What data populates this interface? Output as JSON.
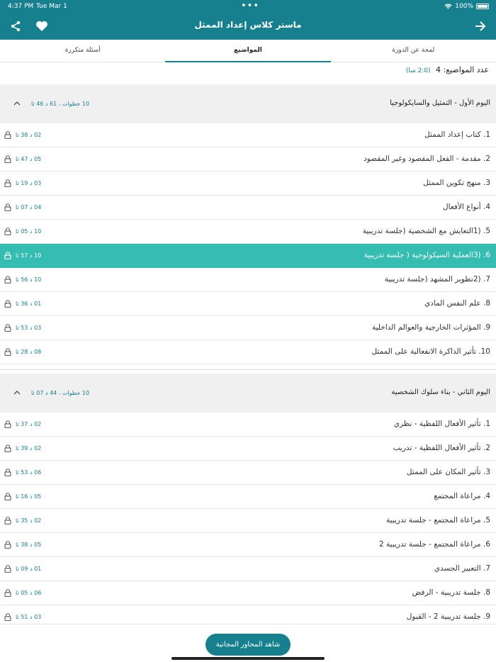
{
  "status_bar": {
    "time": "4:37 PM",
    "date": "Tue Mar 1",
    "dots": "•••",
    "battery": "100%"
  },
  "header": {
    "title": "ماستر كلاس إعداد الممثل",
    "share_icon": "share-icon",
    "heart_icon": "heart-icon",
    "back_icon": "arrow-right-icon",
    "color": "#17808f"
  },
  "tabs": [
    {
      "label": "لمحة عن الدورة"
    },
    {
      "label": "المواضيع"
    },
    {
      "label": "أسئلة متكررة"
    }
  ],
  "summary": {
    "label": "عدد المواضيع: 4",
    "duration": "(2:0 سا)"
  },
  "sections": [
    {
      "title": "اليوم الأول - التمثيل والسايكولوجيا",
      "meta": "10 خطوات ، 61 د 46 ثا",
      "items": [
        {
          "label": "1. كتاب إعداد الممثل",
          "duration": "02 د 38 ثا"
        },
        {
          "label": "2. مقدمة - الفعل المقصود وغير المقصود",
          "duration": "05 د 47 ثا"
        },
        {
          "label": "3. منهج تكوين الممثل",
          "duration": "03 د 19 ثا"
        },
        {
          "label": "4. أنواع الأفعال",
          "duration": "04 د 07 ثا"
        },
        {
          "label": "5. (1التعايش مع الشخصية (جلسة تدريبية",
          "duration": "10 د 05 ثا"
        },
        {
          "label": "6. (3العملية السيكولوجية ( جلسة تدريبية",
          "duration": "10 د 57 ثا"
        },
        {
          "label": "7. (2تطوير المشهد (جلسة تدريبية",
          "duration": "10 د 56 ثا"
        },
        {
          "label": "8. علم النفس المادي",
          "duration": "01 د 36 ثا"
        },
        {
          "label": "9. المؤثرات الخارجية والعوالم الداخلية",
          "duration": "03 د 53 ثا"
        },
        {
          "label": "10. تأثير الذاكرة الانفعالية على الممثل",
          "duration": "08 د 28 ثا"
        }
      ]
    },
    {
      "title": "اليوم الثاني - بناء سلوك الشخصية",
      "meta": "10 خطوات ، 44 د 07 ثا",
      "items": [
        {
          "label": "1. تأثير الأفعال اللفظية - نظري",
          "duration": "02 د 37 ثا"
        },
        {
          "label": "2. تأثير الأفعال اللفظية - تدريب",
          "duration": "02 د 39 ثا"
        },
        {
          "label": "3. تأثير المكان على الممثل",
          "duration": "06 د 53 ثا"
        },
        {
          "label": "4. مراعاة المجتمع",
          "duration": "05 د 16 ثا"
        },
        {
          "label": "5. مراعاة المجتمع - جلسة تدريبية",
          "duration": "02 د 35 ثا"
        },
        {
          "label": "6. مراعاة المجتمع - جلسة تدريبية 2",
          "duration": "05 د 38 ثا"
        },
        {
          "label": "7. التعبير الجسدي",
          "duration": "01 د 09 ثا"
        },
        {
          "label": "8. جلسة تدريبية - الرفض",
          "duration": "06 د 05 ثا"
        },
        {
          "label": "9. جلسة تدريبية 2 - القبول",
          "duration": "03 د 51 ثا"
        }
      ]
    }
  ],
  "cta": {
    "label": "شاهد المحاور المجانية"
  }
}
